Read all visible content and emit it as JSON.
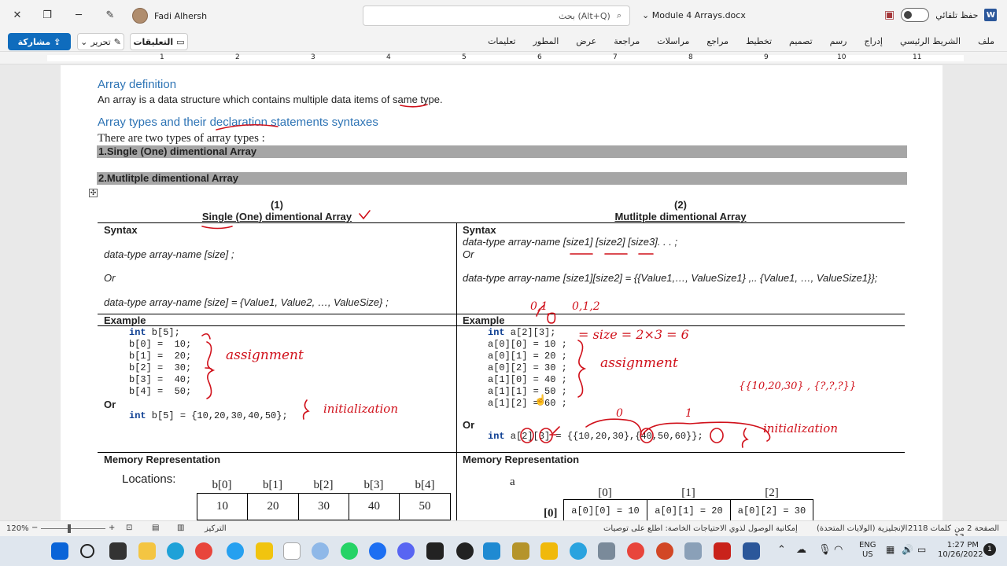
{
  "window": {
    "doc_name": "Module 4 Arrays.docx",
    "user_name": "Fadi Alhersh",
    "search_placeholder": "بحث (Alt+Q)",
    "autosave_label": "حفظ تلقائي"
  },
  "ribbon": {
    "share_label": "مشاركة",
    "edit_label": "تحرير",
    "comments_label": "التعليقات",
    "tabs": [
      "ملف",
      "الشريط الرئيسي",
      "إدراج",
      "رسم",
      "تصميم",
      "تخطيط",
      "مراجع",
      "مراسلات",
      "مراجعة",
      "عرض",
      "المطور",
      "تعليمات"
    ]
  },
  "ruler": {
    "numbers": [
      "1",
      "2",
      "3",
      "4",
      "5",
      "6",
      "7",
      "8",
      "9",
      "10",
      "11"
    ]
  },
  "document": {
    "heading1": "Array definition",
    "para1_pre": "An array is a data structure which contains multiple data items of ",
    "para1_same": "same",
    "para1_post": " type.",
    "heading2": "Array types and their declaration statements syntaxes",
    "para2": "There are two types of array types :",
    "bar1": "1.Single (One) dimentional Array",
    "bar2": "2.Mutlitple dimentional Array",
    "col1_num": "(1)",
    "col1_title": "Single (One) dimentional Array",
    "col2_num": "(2)",
    "col2_title": "Mutlitple dimentional Array",
    "syntax_label": "Syntax",
    "example_label": "Example",
    "or_label": "Or",
    "memory_label": "Memory Representation",
    "locations_label": "Locations:",
    "left_syntax": [
      "data-type   array-name [size] ;",
      "Or",
      "data-type   array-name [size] = {Value1, Value2, …, ValueSize} ;"
    ],
    "right_syntax": [
      "data-type   array-name [size1] [size2] [size3]. . . ;",
      "Or",
      "data-type   array-name [size1][size2] = {{Value1,…, ValueSize1} ,.. {Value1, …, ValueSize1}};"
    ],
    "left_code_decl_kw": "int",
    "left_code_decl": " b[5];",
    "left_code": [
      "b[0] =  10;",
      "b[1] =  20;",
      "b[2] =  30;",
      "b[3] =  40;",
      "b[4] =  50;"
    ],
    "left_init": " b[5] = {10,20,30,40,50};",
    "right_code_decl": " a[2][3];",
    "right_code": [
      "a[0][0] = 10 ;",
      "a[0][1] = 20 ;",
      "a[0][2] = 30 ;",
      "a[1][0] = 40 ;",
      "a[1][1] = 50 ;",
      "a[1][2] = 60 ;"
    ],
    "right_init": " a[2][3] = {{10,20,30},{40,50,60}};",
    "mem_left_headers": [
      "b[0]",
      "b[1]",
      "b[2]",
      "b[3]",
      "b[4]"
    ],
    "mem_left_values": [
      "10",
      "20",
      "30",
      "40",
      "50"
    ],
    "mem_right_name": "a",
    "mem_right_col_headers": [
      "[0]",
      "[1]",
      "[2]"
    ],
    "mem_right_row_header": "[0]",
    "mem_right_cells": [
      "a[0][0] = 10",
      "a[0][1] = 20",
      "a[0][2] = 30"
    ],
    "handwriting": {
      "assignment": "assignment",
      "initialization": "initialization",
      "size_note": "= size = 2×3 = 6",
      "indices_note1": "0,1",
      "indices_note2": "0,1,2",
      "group0": "0",
      "group1": "1",
      "braces_note": "{{10,20,30} , {?,?,?}}"
    }
  },
  "statusbar": {
    "page": "الصفحة 2 من 13",
    "words": "2118 كلمات",
    "language": "الإنجليزية (الولايات المتحدة)",
    "accessibility": "إمكانية الوصول لذوي الاحتياجات الخاصة: اطلع على توصيات",
    "focus": "التركيز",
    "zoom": "120%"
  },
  "taskbar": {
    "lang1": "ENG",
    "lang2": "US",
    "time": "1:27 PM",
    "date": "10/26/2022"
  }
}
